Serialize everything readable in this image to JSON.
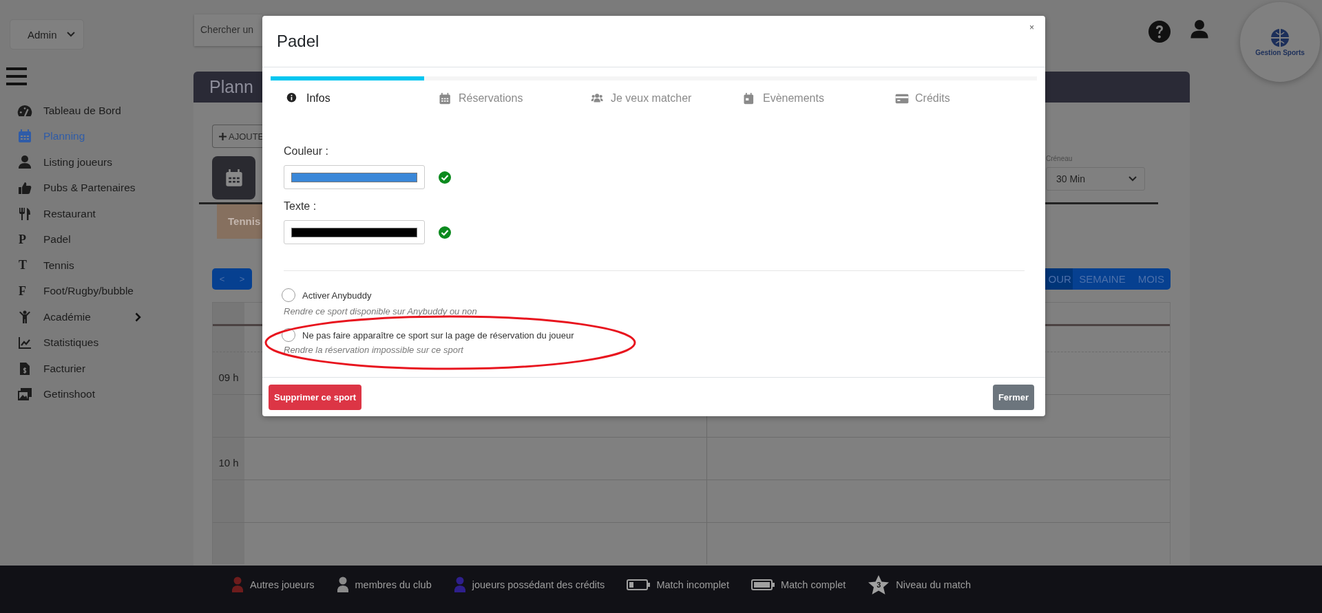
{
  "sidebar": {
    "role_select": "Admin",
    "items": [
      {
        "label": "Tableau de Bord",
        "selected": false,
        "has_submenu": false
      },
      {
        "label": "Planning",
        "selected": true,
        "has_submenu": false
      },
      {
        "label": "Listing joueurs",
        "selected": false,
        "has_submenu": false
      },
      {
        "label": "Pubs & Partenaires",
        "selected": false,
        "has_submenu": false
      },
      {
        "label": "Restaurant",
        "selected": false,
        "has_submenu": false
      },
      {
        "label": "Padel",
        "glyph": "P",
        "selected": false,
        "has_submenu": false
      },
      {
        "label": "Tennis",
        "glyph": "T",
        "selected": false,
        "has_submenu": false
      },
      {
        "label": "Foot/Rugby/bubble",
        "glyph": "F",
        "selected": false,
        "has_submenu": false
      },
      {
        "label": "Académie",
        "selected": false,
        "has_submenu": true
      },
      {
        "label": "Statistiques",
        "selected": false,
        "has_submenu": false
      },
      {
        "label": "Facturier",
        "selected": false,
        "has_submenu": false
      },
      {
        "label": "Getinshoot",
        "selected": false,
        "has_submenu": false
      }
    ]
  },
  "header": {
    "search": {
      "placeholder": "Chercher un"
    }
  },
  "logo": {
    "text": "Gestion Sports"
  },
  "planning": {
    "title": "Plann",
    "add_button": "AJOUTE",
    "slot_label": "Créneau",
    "slot_value": "30 Min",
    "sport_tab": "Tennis",
    "nav": [
      "<",
      ">"
    ],
    "views": [
      {
        "label": "OUR",
        "selected": true
      },
      {
        "label": "SEMAINE",
        "selected": false
      },
      {
        "label": "MOIS",
        "selected": false
      }
    ],
    "hours": [
      "09 h",
      "10 h"
    ]
  },
  "modal": {
    "title": "Padel",
    "close": "×",
    "progress": {
      "level": 0.2
    },
    "tabs": [
      {
        "label": "Infos",
        "selected": true
      },
      {
        "label": "Réservations",
        "selected": false
      },
      {
        "label": "Je veux matcher",
        "selected": false
      },
      {
        "label": "Evènements",
        "selected": false
      },
      {
        "label": "Crédits",
        "selected": false
      }
    ],
    "fields": [
      {
        "label": "Couleur :",
        "color": "#3a87d8",
        "valid": true
      },
      {
        "label": "Texte :",
        "color": "#000000",
        "valid": true
      }
    ],
    "options": [
      {
        "label": "Activer Anybuddy",
        "hint": "Rendre ce sport disponible sur Anybuddy ou non",
        "checked": false,
        "highlighted": false
      },
      {
        "label": "Ne pas faire apparaître ce sport sur la page de réservation du joueur",
        "hint": "Rendre la réservation impossible sur ce sport",
        "checked": false,
        "highlighted": true
      }
    ],
    "buttons": [
      {
        "label": "Supprimer ce sport",
        "kind": "danger"
      },
      {
        "label": "Fermer",
        "kind": "secondary"
      }
    ]
  },
  "legend": [
    {
      "kind": "person",
      "label": "Autres joueurs",
      "color": "#6e1c1c"
    },
    {
      "kind": "person",
      "label": "membres du club",
      "color": "#8a8a8a"
    },
    {
      "kind": "person",
      "label": "joueurs possédant des crédits",
      "color": "#2e1f8c"
    },
    {
      "kind": "battery-low",
      "label": "Match incomplet"
    },
    {
      "kind": "battery-full",
      "label": "Match complet"
    },
    {
      "kind": "star",
      "badge": "3",
      "label": "Niveau du match"
    }
  ]
}
